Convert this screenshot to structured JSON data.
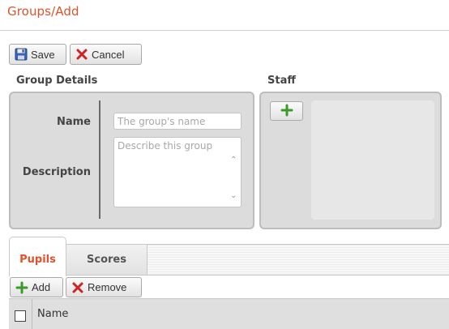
{
  "page": {
    "title": "Groups/Add"
  },
  "toolbar": {
    "save_label": "Save",
    "cancel_label": "Cancel"
  },
  "group_details": {
    "heading": "Group Details",
    "name_label": "Name",
    "name_placeholder": "The group's name",
    "name_value": "",
    "description_label": "Description",
    "description_placeholder": "Describe this group",
    "description_value": ""
  },
  "staff": {
    "heading": "Staff",
    "add_icon": "plus-icon"
  },
  "tabs": [
    {
      "label": "Pupils",
      "active": true
    },
    {
      "label": "Scores",
      "active": false
    }
  ],
  "pupils_toolbar": {
    "add_label": "Add",
    "remove_label": "Remove"
  },
  "grid": {
    "columns": [
      {
        "label": "Name"
      }
    ],
    "select_all_checked": false
  },
  "colors": {
    "accent": "#e0522b",
    "panel": "#dcdcdc",
    "plus_green": "#3a9a2a",
    "cancel_red": "#d02222"
  }
}
